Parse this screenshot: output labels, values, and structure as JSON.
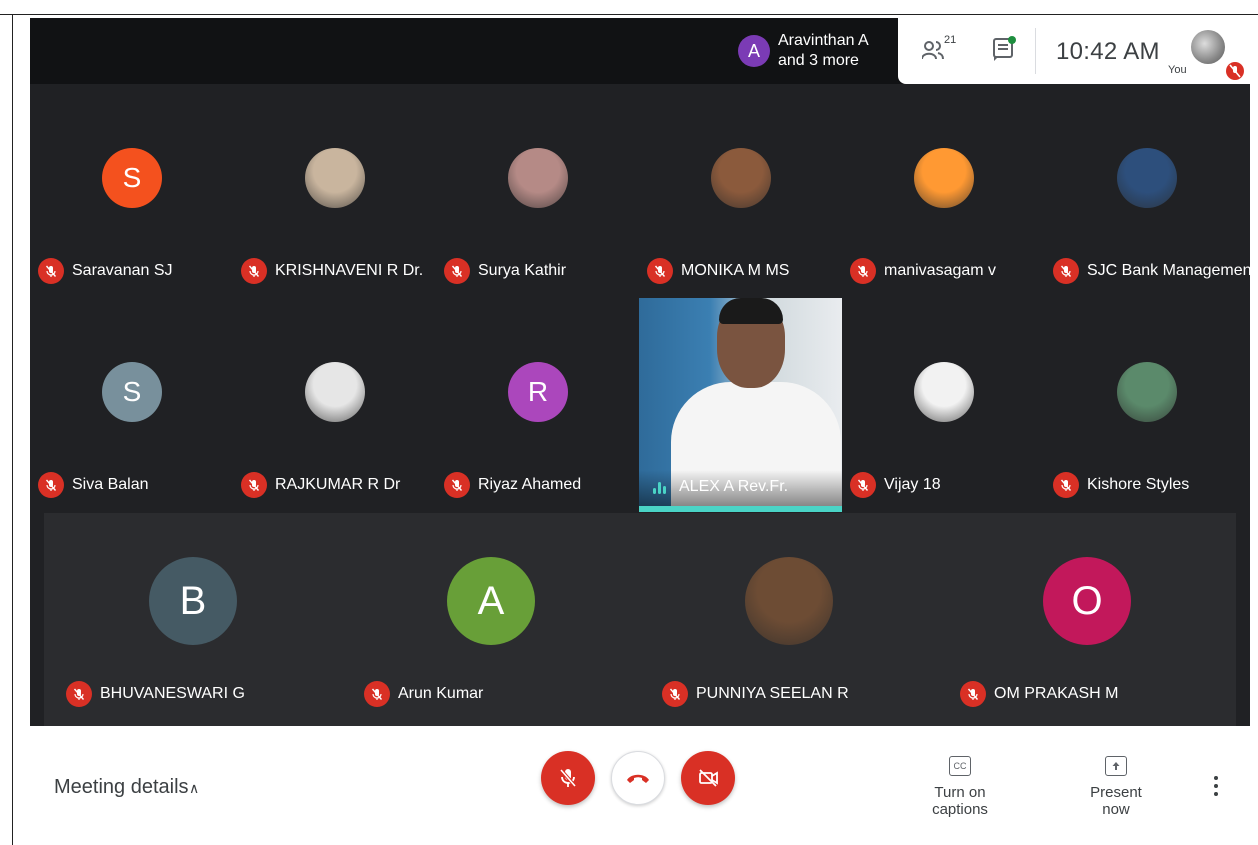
{
  "topbar": {
    "speaker_initial": "A",
    "speaker_line1": "Aravinthan A",
    "speaker_line2": "and 3 more",
    "people_count": "21",
    "time": "10:42 AM",
    "self_label": "You"
  },
  "row1": [
    {
      "name": "Saravanan SJ",
      "initial": "S",
      "color": "#f4511e"
    },
    {
      "name": "KRISHNAVENI R Dr.",
      "initial": "",
      "color": "#c9b59e"
    },
    {
      "name": "Surya Kathir",
      "initial": "",
      "color": "#b58a86"
    },
    {
      "name": "MONIKA M MS",
      "initial": "",
      "color": "#8b5a3c"
    },
    {
      "name": "manivasagam v",
      "initial": "",
      "color": "#ff9933"
    },
    {
      "name": "SJC Bank Management",
      "initial": "",
      "color": "#2d4f7c"
    }
  ],
  "row2": [
    {
      "name": "Siva Balan",
      "initial": "S",
      "color": "#78909c"
    },
    {
      "name": "RAJKUMAR R Dr",
      "initial": "",
      "color": "#e6e6e6"
    },
    {
      "name": "Riyaz Ahamed",
      "initial": "R",
      "color": "#ab47bc"
    },
    {
      "name": "ALEX A Rev.Fr.",
      "initial": "",
      "color": "#4ad4c6"
    },
    {
      "name": "Vijay 18",
      "initial": "",
      "color": "#f2f2f2"
    },
    {
      "name": "Kishore Styles",
      "initial": "",
      "color": "#5b8a6b"
    }
  ],
  "row3": [
    {
      "name": "BHUVANESWARI G",
      "initial": "B",
      "color": "#455a64"
    },
    {
      "name": "Arun Kumar",
      "initial": "A",
      "color": "#689f38"
    },
    {
      "name": "PUNNIYA SEELAN R",
      "initial": "",
      "color": "#6d4c34"
    },
    {
      "name": "OM PRAKASH M",
      "initial": "O",
      "color": "#c2185b"
    }
  ],
  "bottombar": {
    "meeting_details": "Meeting details",
    "captions_label": "Turn on captions",
    "captions_icon_text": "CC",
    "present_label": "Present now"
  }
}
